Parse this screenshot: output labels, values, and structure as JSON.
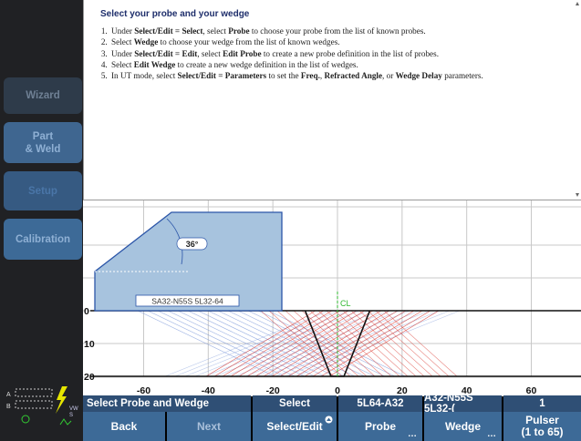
{
  "sidebar": {
    "items": [
      {
        "label": "Wizard"
      },
      {
        "label": "Part\n& Weld"
      },
      {
        "label": "Setup"
      },
      {
        "label": "Calibration"
      }
    ]
  },
  "help": {
    "title": "Select your probe and your wedge",
    "steps": [
      [
        "Under ",
        {
          "b": "Select/Edit = Select"
        },
        ", select ",
        {
          "b": "Probe"
        },
        " to choose your probe from the list of known probes."
      ],
      [
        "Select ",
        {
          "b": "Wedge"
        },
        " to choose your wedge from the list of known wedges."
      ],
      [
        "Under ",
        {
          "b": "Select/Edit = Edit"
        },
        ", select ",
        {
          "b": "Edit Probe"
        },
        " to create a new probe definition in the list of probes."
      ],
      [
        "Select ",
        {
          "b": "Edit Wedge"
        },
        " to create a new wedge definition in the list of wedges."
      ],
      [
        "In UT mode, select ",
        {
          "b": "Select/Edit = Parameters"
        },
        " to set the ",
        {
          "b": "Freq."
        },
        ", ",
        {
          "b": "Refracted Angle"
        },
        ", or ",
        {
          "b": "Wedge Delay"
        },
        " parameters."
      ]
    ]
  },
  "plot": {
    "wedge_label": "SA32-N55S 5L32-64",
    "angle_label": "36°",
    "cl_label": "CL",
    "x_ticks": [
      "-60",
      "-40",
      "-20",
      "0",
      "20",
      "40",
      "60"
    ],
    "y_ticks": [
      "0",
      "10",
      "20"
    ]
  },
  "status": {
    "mode": "Select Probe and Wedge",
    "select": "Select",
    "probe": "5L64-A32",
    "wedge": "A32-N55S 5L32-(",
    "pulser": "1"
  },
  "buttons": {
    "back": "Back",
    "next": "Next",
    "select_edit": "Select/Edit",
    "probe": "Probe",
    "wedge": "Wedge",
    "pulser": "Pulser\n(1 to 65)"
  },
  "colors": {
    "accent": "#3d6a97",
    "status_bar": "#2f4f75",
    "wedge_fill": "#a7c3de",
    "beam_red": "#d9332b",
    "beam_blue": "#6f8ed6",
    "cl_green": "#2fb82f"
  }
}
